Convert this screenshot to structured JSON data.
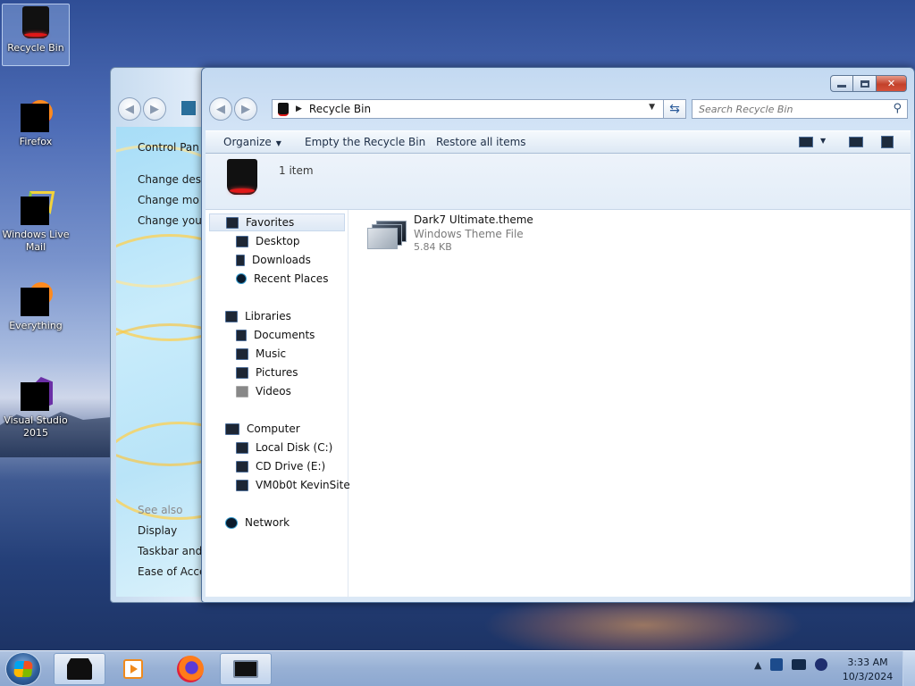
{
  "desktop": {
    "icons": [
      {
        "label": "Recycle Bin"
      },
      {
        "label": "Firefox"
      },
      {
        "label": "Windows Live Mail"
      },
      {
        "label": "Everything"
      },
      {
        "label": "Visual Studio 2015"
      }
    ]
  },
  "control_panel": {
    "links": [
      "Control Pan",
      "Change desl",
      "Change mo",
      "Change you"
    ],
    "see_also_title": "See also",
    "see_also": [
      "Display",
      "Taskbar and",
      "Ease of Acce"
    ]
  },
  "window": {
    "title": "Recycle Bin",
    "address": {
      "location": "Recycle Bin"
    },
    "search": {
      "placeholder": "Search Recycle Bin"
    },
    "toolbar": {
      "organize": "Organize",
      "empty": "Empty the Recycle Bin",
      "restore": "Restore all items"
    },
    "details": {
      "count": "1 item"
    },
    "nav": {
      "favorites": "Favorites",
      "desktop": "Desktop",
      "downloads": "Downloads",
      "recent": "Recent Places",
      "libraries": "Libraries",
      "documents": "Documents",
      "music": "Music",
      "pictures": "Pictures",
      "videos": "Videos",
      "computer": "Computer",
      "local_disk": "Local Disk (C:)",
      "cd_drive": "CD Drive (E:)",
      "vm_site": "VM0b0t KevinSite",
      "network": "Network"
    },
    "files": [
      {
        "name": "Dark7 Ultimate.theme",
        "type": "Windows Theme File",
        "size": "5.84 KB"
      }
    ]
  },
  "taskbar": {
    "clock": {
      "time": "3:33 AM",
      "date": "10/3/2024"
    },
    "tray_arrow": "▲"
  },
  "colors": {
    "accent_red": "#e01818",
    "window_frame": "#c3d9f1"
  }
}
